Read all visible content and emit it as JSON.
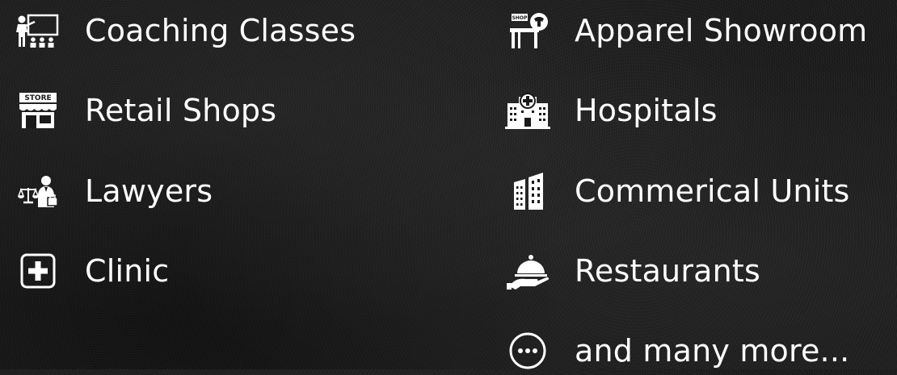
{
  "left_column": [
    {
      "label": "Coaching Classes",
      "icon": "teacher-classroom-icon"
    },
    {
      "label": "Retail Shops",
      "icon": "store-front-icon"
    },
    {
      "label": "Lawyers",
      "icon": "lawyer-scales-icon"
    },
    {
      "label": "Clinic",
      "icon": "medical-plus-icon"
    }
  ],
  "right_column": [
    {
      "label": "Apparel Showroom",
      "icon": "apparel-shop-icon"
    },
    {
      "label": "Hospitals",
      "icon": "hospital-building-icon"
    },
    {
      "label": "Commerical Units",
      "icon": "office-buildings-icon"
    },
    {
      "label": "Restaurants",
      "icon": "serving-cloche-icon"
    },
    {
      "label": "and many more...",
      "icon": "more-dots-icon"
    }
  ],
  "store_sign_text": "STORE",
  "shop_sign_text": "SHOP",
  "colors": {
    "text": "#ffffff",
    "background": "#1a1a1a"
  }
}
